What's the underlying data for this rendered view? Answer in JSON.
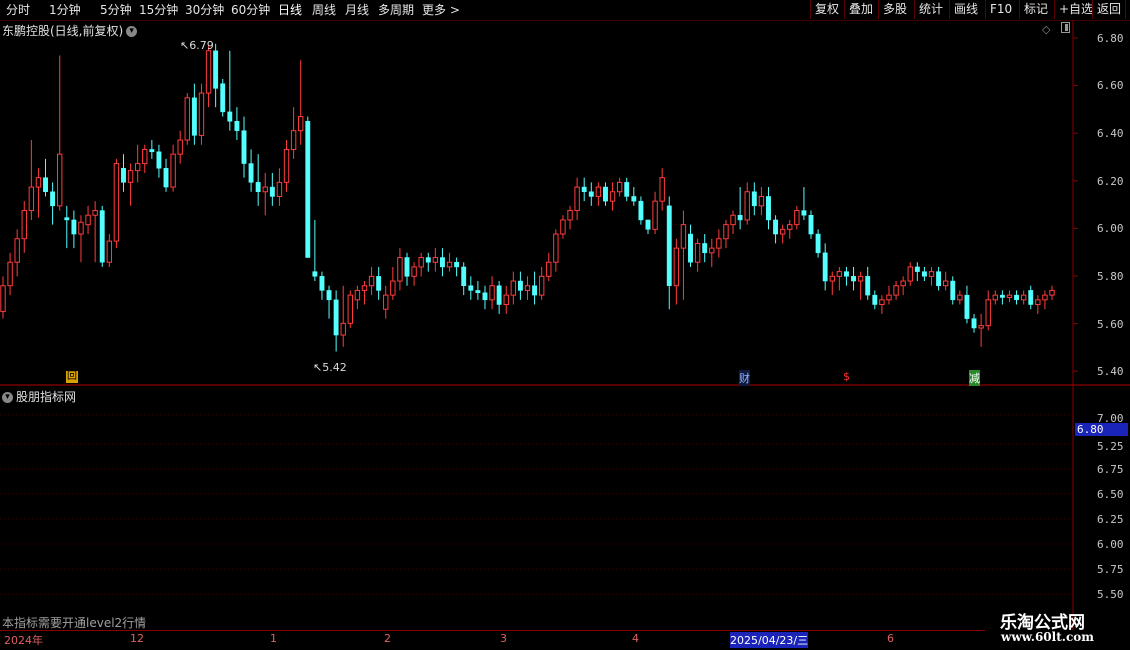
{
  "toolbar": {
    "tabs": [
      "分时",
      "1分钟",
      "5分钟",
      "15分钟",
      "30分钟",
      "60分钟",
      "日线",
      "周线",
      "月线",
      "多周期",
      "更多 >"
    ],
    "active_tab": "日线",
    "right_buttons": [
      "复权",
      "叠加",
      "多股",
      "统计",
      "画线",
      "F10",
      "标记",
      "+自选",
      "返回"
    ]
  },
  "stock": {
    "title": "东鹏控股(日线,前复权)"
  },
  "price_axis": {
    "labels": [
      "6.80",
      "6.60",
      "6.40",
      "6.20",
      "6.00",
      "5.80",
      "5.60",
      "5.40"
    ]
  },
  "annotations": {
    "high": "6.79",
    "low": "5.42"
  },
  "markers": {
    "hui": "回",
    "cai": "财",
    "dollar": "$",
    "jian": "减"
  },
  "indicator": {
    "title": "股朋指标网",
    "axis_labels": [
      "7.00",
      "6.75",
      "6.50",
      "6.25",
      "6.00",
      "5.75",
      "5.50",
      "5.25"
    ],
    "current_value": "6.80",
    "note": "本指标需要开通level2行情"
  },
  "time_axis": {
    "labels": [
      "2024年",
      "12",
      "1",
      "2",
      "3",
      "4",
      "2025/04/23/三",
      "6"
    ]
  },
  "watermark": {
    "line1": "乐淘公式网",
    "line2": "www.60lt.com"
  },
  "colors": {
    "up": "#ff3c3c",
    "down": "#54ffff",
    "grid_red": "#8a0000",
    "bg": "#000000"
  },
  "chart_data": {
    "type": "candlestick",
    "ylim": [
      5.38,
      6.84
    ],
    "ohlc": [
      [
        5.65,
        5.8,
        5.62,
        5.76
      ],
      [
        5.76,
        5.9,
        5.72,
        5.86
      ],
      [
        5.86,
        6.0,
        5.8,
        5.96
      ],
      [
        5.96,
        6.12,
        5.9,
        6.08
      ],
      [
        6.08,
        6.38,
        6.04,
        6.18
      ],
      [
        6.18,
        6.26,
        6.05,
        6.22
      ],
      [
        6.22,
        6.3,
        6.14,
        6.16
      ],
      [
        6.16,
        6.2,
        6.02,
        6.1
      ],
      [
        6.1,
        6.74,
        6.08,
        6.32
      ],
      [
        6.05,
        6.1,
        5.92,
        6.04
      ],
      [
        6.04,
        6.08,
        5.92,
        5.98
      ],
      [
        5.98,
        6.06,
        5.86,
        6.03
      ],
      [
        6.02,
        6.1,
        5.98,
        6.06
      ],
      [
        6.06,
        6.12,
        5.86,
        6.08
      ],
      [
        6.08,
        6.1,
        5.84,
        5.86
      ],
      [
        5.86,
        5.98,
        5.84,
        5.95
      ],
      [
        5.95,
        6.3,
        5.92,
        6.28
      ],
      [
        6.26,
        6.32,
        6.16,
        6.2
      ],
      [
        6.2,
        6.28,
        6.1,
        6.25
      ],
      [
        6.25,
        6.36,
        6.2,
        6.28
      ],
      [
        6.28,
        6.36,
        6.24,
        6.34
      ],
      [
        6.34,
        6.38,
        6.3,
        6.33
      ],
      [
        6.33,
        6.36,
        6.22,
        6.26
      ],
      [
        6.26,
        6.3,
        6.16,
        6.18
      ],
      [
        6.18,
        6.36,
        6.16,
        6.32
      ],
      [
        6.32,
        6.42,
        6.28,
        6.38
      ],
      [
        6.38,
        6.58,
        6.36,
        6.56
      ],
      [
        6.56,
        6.62,
        6.36,
        6.4
      ],
      [
        6.4,
        6.62,
        6.36,
        6.58
      ],
      [
        6.58,
        6.78,
        6.52,
        6.76
      ],
      [
        6.76,
        6.79,
        6.52,
        6.6
      ],
      [
        6.62,
        6.64,
        6.48,
        6.5
      ],
      [
        6.5,
        6.76,
        6.42,
        6.46
      ],
      [
        6.46,
        6.52,
        6.38,
        6.42
      ],
      [
        6.42,
        6.48,
        6.22,
        6.28
      ],
      [
        6.28,
        6.34,
        6.16,
        6.2
      ],
      [
        6.2,
        6.32,
        6.1,
        6.16
      ],
      [
        6.16,
        6.24,
        6.06,
        6.18
      ],
      [
        6.18,
        6.24,
        6.1,
        6.14
      ],
      [
        6.14,
        6.26,
        6.1,
        6.2
      ],
      [
        6.2,
        6.38,
        6.16,
        6.34
      ],
      [
        6.34,
        6.52,
        6.3,
        6.42
      ],
      [
        6.42,
        6.72,
        6.36,
        6.48
      ],
      [
        6.46,
        6.48,
        5.9,
        5.88
      ],
      [
        5.82,
        6.04,
        5.78,
        5.8
      ],
      [
        5.8,
        5.82,
        5.7,
        5.74
      ],
      [
        5.74,
        5.76,
        5.62,
        5.7
      ],
      [
        5.7,
        5.74,
        5.48,
        5.55
      ],
      [
        5.55,
        5.76,
        5.5,
        5.6
      ],
      [
        5.6,
        5.74,
        5.58,
        5.72
      ],
      [
        5.7,
        5.76,
        5.66,
        5.74
      ],
      [
        5.74,
        5.78,
        5.68,
        5.76
      ],
      [
        5.76,
        5.84,
        5.72,
        5.8
      ],
      [
        5.8,
        5.84,
        5.7,
        5.74
      ],
      [
        5.66,
        5.76,
        5.62,
        5.72
      ],
      [
        5.72,
        5.84,
        5.7,
        5.78
      ],
      [
        5.78,
        5.92,
        5.74,
        5.88
      ],
      [
        5.88,
        5.9,
        5.76,
        5.8
      ],
      [
        5.8,
        5.86,
        5.76,
        5.84
      ],
      [
        5.84,
        5.9,
        5.8,
        5.88
      ],
      [
        5.88,
        5.9,
        5.82,
        5.86
      ],
      [
        5.86,
        5.92,
        5.82,
        5.88
      ],
      [
        5.88,
        5.92,
        5.8,
        5.84
      ],
      [
        5.84,
        5.9,
        5.82,
        5.86
      ],
      [
        5.86,
        5.88,
        5.8,
        5.84
      ],
      [
        5.84,
        5.86,
        5.72,
        5.76
      ],
      [
        5.76,
        5.8,
        5.7,
        5.74
      ],
      [
        5.74,
        5.78,
        5.7,
        5.73
      ],
      [
        5.73,
        5.76,
        5.66,
        5.7
      ],
      [
        5.7,
        5.8,
        5.66,
        5.76
      ],
      [
        5.76,
        5.78,
        5.64,
        5.68
      ],
      [
        5.68,
        5.76,
        5.64,
        5.72
      ],
      [
        5.72,
        5.82,
        5.68,
        5.78
      ],
      [
        5.78,
        5.82,
        5.7,
        5.74
      ],
      [
        5.74,
        5.8,
        5.7,
        5.76
      ],
      [
        5.76,
        5.82,
        5.68,
        5.72
      ],
      [
        5.72,
        5.84,
        5.7,
        5.8
      ],
      [
        5.8,
        5.9,
        5.78,
        5.86
      ],
      [
        5.86,
        6.0,
        5.82,
        5.98
      ],
      [
        5.98,
        6.06,
        5.96,
        6.04
      ],
      [
        6.04,
        6.1,
        6.0,
        6.08
      ],
      [
        6.08,
        6.22,
        6.04,
        6.18
      ],
      [
        6.18,
        6.22,
        6.12,
        6.16
      ],
      [
        6.16,
        6.2,
        6.1,
        6.14
      ],
      [
        6.14,
        6.2,
        6.1,
        6.18
      ],
      [
        6.18,
        6.2,
        6.1,
        6.12
      ],
      [
        6.12,
        6.2,
        6.08,
        6.16
      ],
      [
        6.16,
        6.22,
        6.14,
        6.2
      ],
      [
        6.2,
        6.22,
        6.12,
        6.14
      ],
      [
        6.14,
        6.18,
        6.1,
        6.12
      ],
      [
        6.12,
        6.14,
        6.02,
        6.04
      ],
      [
        6.04,
        6.02,
        5.98,
        6.0
      ],
      [
        6.0,
        6.16,
        5.98,
        6.12
      ],
      [
        6.12,
        6.26,
        6.08,
        6.22
      ],
      [
        6.1,
        6.14,
        5.66,
        5.76
      ],
      [
        5.76,
        5.96,
        5.68,
        5.92
      ],
      [
        5.92,
        6.08,
        5.7,
        6.02
      ],
      [
        5.98,
        6.02,
        5.84,
        5.86
      ],
      [
        5.86,
        5.96,
        5.82,
        5.94
      ],
      [
        5.94,
        5.98,
        5.86,
        5.9
      ],
      [
        5.9,
        5.96,
        5.84,
        5.92
      ],
      [
        5.92,
        6.0,
        5.88,
        5.96
      ],
      [
        5.96,
        6.04,
        5.92,
        6.02
      ],
      [
        6.02,
        6.08,
        5.98,
        6.06
      ],
      [
        6.06,
        6.18,
        6.0,
        6.04
      ],
      [
        6.04,
        6.2,
        6.02,
        6.16
      ],
      [
        6.16,
        6.2,
        6.06,
        6.1
      ],
      [
        6.1,
        6.18,
        6.06,
        6.14
      ],
      [
        6.14,
        6.18,
        6.0,
        6.04
      ],
      [
        6.04,
        6.06,
        5.94,
        5.98
      ],
      [
        5.98,
        6.02,
        5.94,
        6.0
      ],
      [
        6.0,
        6.04,
        5.96,
        6.02
      ],
      [
        6.02,
        6.1,
        6.0,
        6.08
      ],
      [
        6.08,
        6.18,
        6.04,
        6.06
      ],
      [
        6.06,
        6.08,
        5.96,
        5.98
      ],
      [
        5.98,
        6.0,
        5.88,
        5.9
      ],
      [
        5.9,
        5.94,
        5.74,
        5.78
      ],
      [
        5.78,
        5.82,
        5.72,
        5.8
      ],
      [
        5.8,
        5.84,
        5.74,
        5.82
      ],
      [
        5.82,
        5.84,
        5.76,
        5.8
      ],
      [
        5.8,
        5.84,
        5.74,
        5.78
      ],
      [
        5.78,
        5.82,
        5.7,
        5.8
      ],
      [
        5.8,
        5.84,
        5.7,
        5.72
      ],
      [
        5.72,
        5.74,
        5.66,
        5.68
      ],
      [
        5.68,
        5.72,
        5.64,
        5.7
      ],
      [
        5.7,
        5.76,
        5.68,
        5.72
      ],
      [
        5.72,
        5.78,
        5.7,
        5.76
      ],
      [
        5.76,
        5.8,
        5.72,
        5.78
      ],
      [
        5.78,
        5.86,
        5.76,
        5.84
      ],
      [
        5.84,
        5.86,
        5.78,
        5.82
      ],
      [
        5.82,
        5.84,
        5.78,
        5.8
      ],
      [
        5.8,
        5.84,
        5.76,
        5.82
      ],
      [
        5.82,
        5.84,
        5.74,
        5.76
      ],
      [
        5.76,
        5.82,
        5.74,
        5.78
      ],
      [
        5.78,
        5.8,
        5.68,
        5.7
      ],
      [
        5.7,
        5.74,
        5.68,
        5.72
      ],
      [
        5.72,
        5.76,
        5.6,
        5.62
      ],
      [
        5.62,
        5.64,
        5.56,
        5.58
      ],
      [
        5.58,
        5.64,
        5.5,
        5.59
      ],
      [
        5.59,
        5.74,
        5.57,
        5.7
      ],
      [
        5.7,
        5.74,
        5.68,
        5.72
      ],
      [
        5.72,
        5.74,
        5.68,
        5.71
      ],
      [
        5.71,
        5.74,
        5.69,
        5.72
      ],
      [
        5.72,
        5.74,
        5.68,
        5.7
      ],
      [
        5.7,
        5.74,
        5.68,
        5.72
      ],
      [
        5.74,
        5.76,
        5.66,
        5.68
      ],
      [
        5.68,
        5.72,
        5.64,
        5.7
      ],
      [
        5.7,
        5.74,
        5.66,
        5.72
      ],
      [
        5.72,
        5.76,
        5.7,
        5.74
      ]
    ]
  }
}
